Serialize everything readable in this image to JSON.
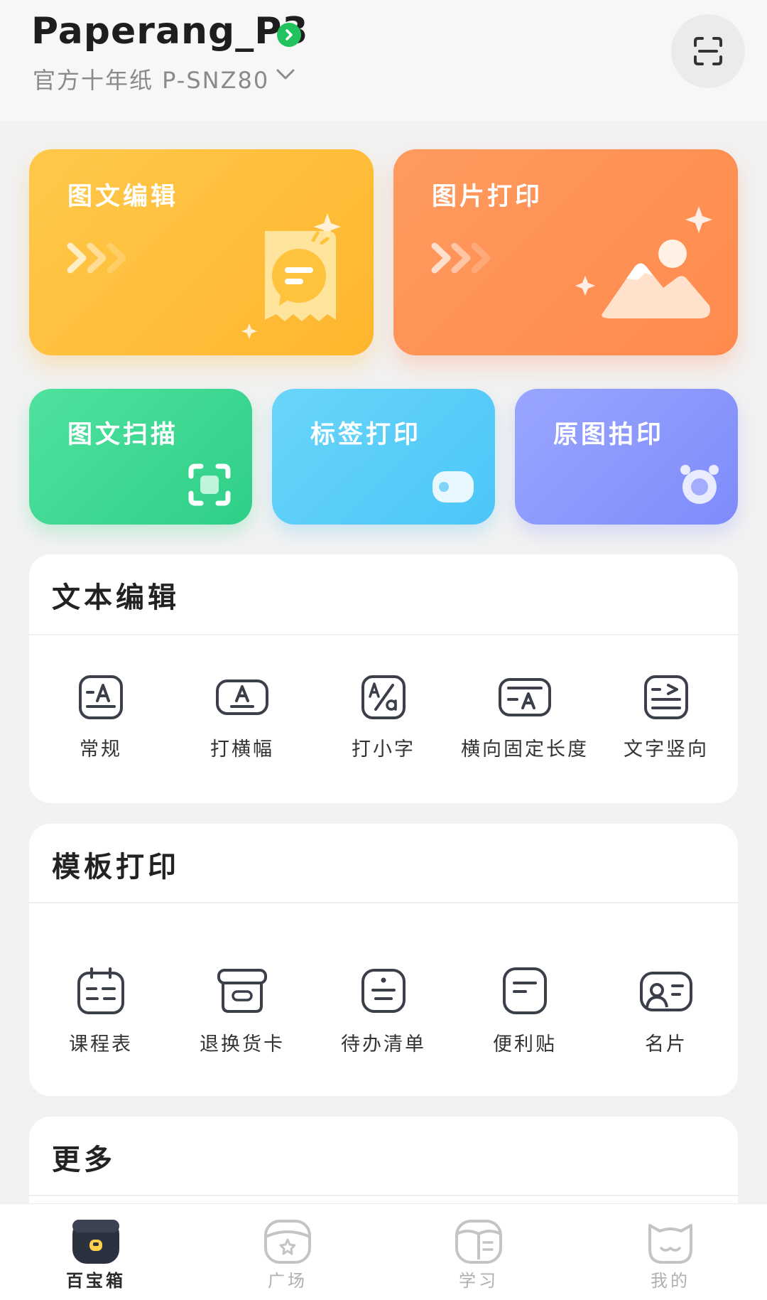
{
  "header": {
    "device_name": "Paperang_P3",
    "paper_type": "官方十年纸 P-SNZ80"
  },
  "feature_cards": [
    {
      "label": "图文编辑",
      "icon": "message-paper-icon"
    },
    {
      "label": "图片打印",
      "icon": "mountain-image-icon"
    },
    {
      "label": "图文扫描",
      "icon": "scan-icon"
    },
    {
      "label": "标签打印",
      "icon": "tag-icon"
    },
    {
      "label": "原图拍印",
      "icon": "camera-icon"
    }
  ],
  "text_edit": {
    "title": "文本编辑",
    "tools": [
      {
        "label": "常规",
        "icon": "text-normal-icon"
      },
      {
        "label": "打横幅",
        "icon": "banner-icon"
      },
      {
        "label": "打小字",
        "icon": "small-text-icon"
      },
      {
        "label": "横向固定长度",
        "icon": "fixed-length-icon"
      },
      {
        "label": "文字竖向",
        "icon": "vertical-text-icon"
      }
    ]
  },
  "template_print": {
    "title": "模板打印",
    "tools": [
      {
        "label": "课程表",
        "icon": "schedule-icon"
      },
      {
        "label": "退换货卡",
        "icon": "return-card-icon"
      },
      {
        "label": "待办清单",
        "icon": "todo-list-icon"
      },
      {
        "label": "便利贴",
        "icon": "sticky-note-icon"
      },
      {
        "label": "名片",
        "icon": "business-card-icon"
      }
    ]
  },
  "more": {
    "title": "更多"
  },
  "tabbar": {
    "tabs": [
      {
        "label": "百宝箱",
        "active": true
      },
      {
        "label": "广场",
        "active": false
      },
      {
        "label": "学习",
        "active": false
      },
      {
        "label": "我的",
        "active": false
      }
    ]
  },
  "colors": {
    "verified": "#22c35e",
    "card_yellow": "#ffbe3c",
    "card_orange": "#ff9157",
    "card_green": "#3ad892",
    "card_blue": "#5ccdf8",
    "card_purple": "#8b97fd"
  }
}
